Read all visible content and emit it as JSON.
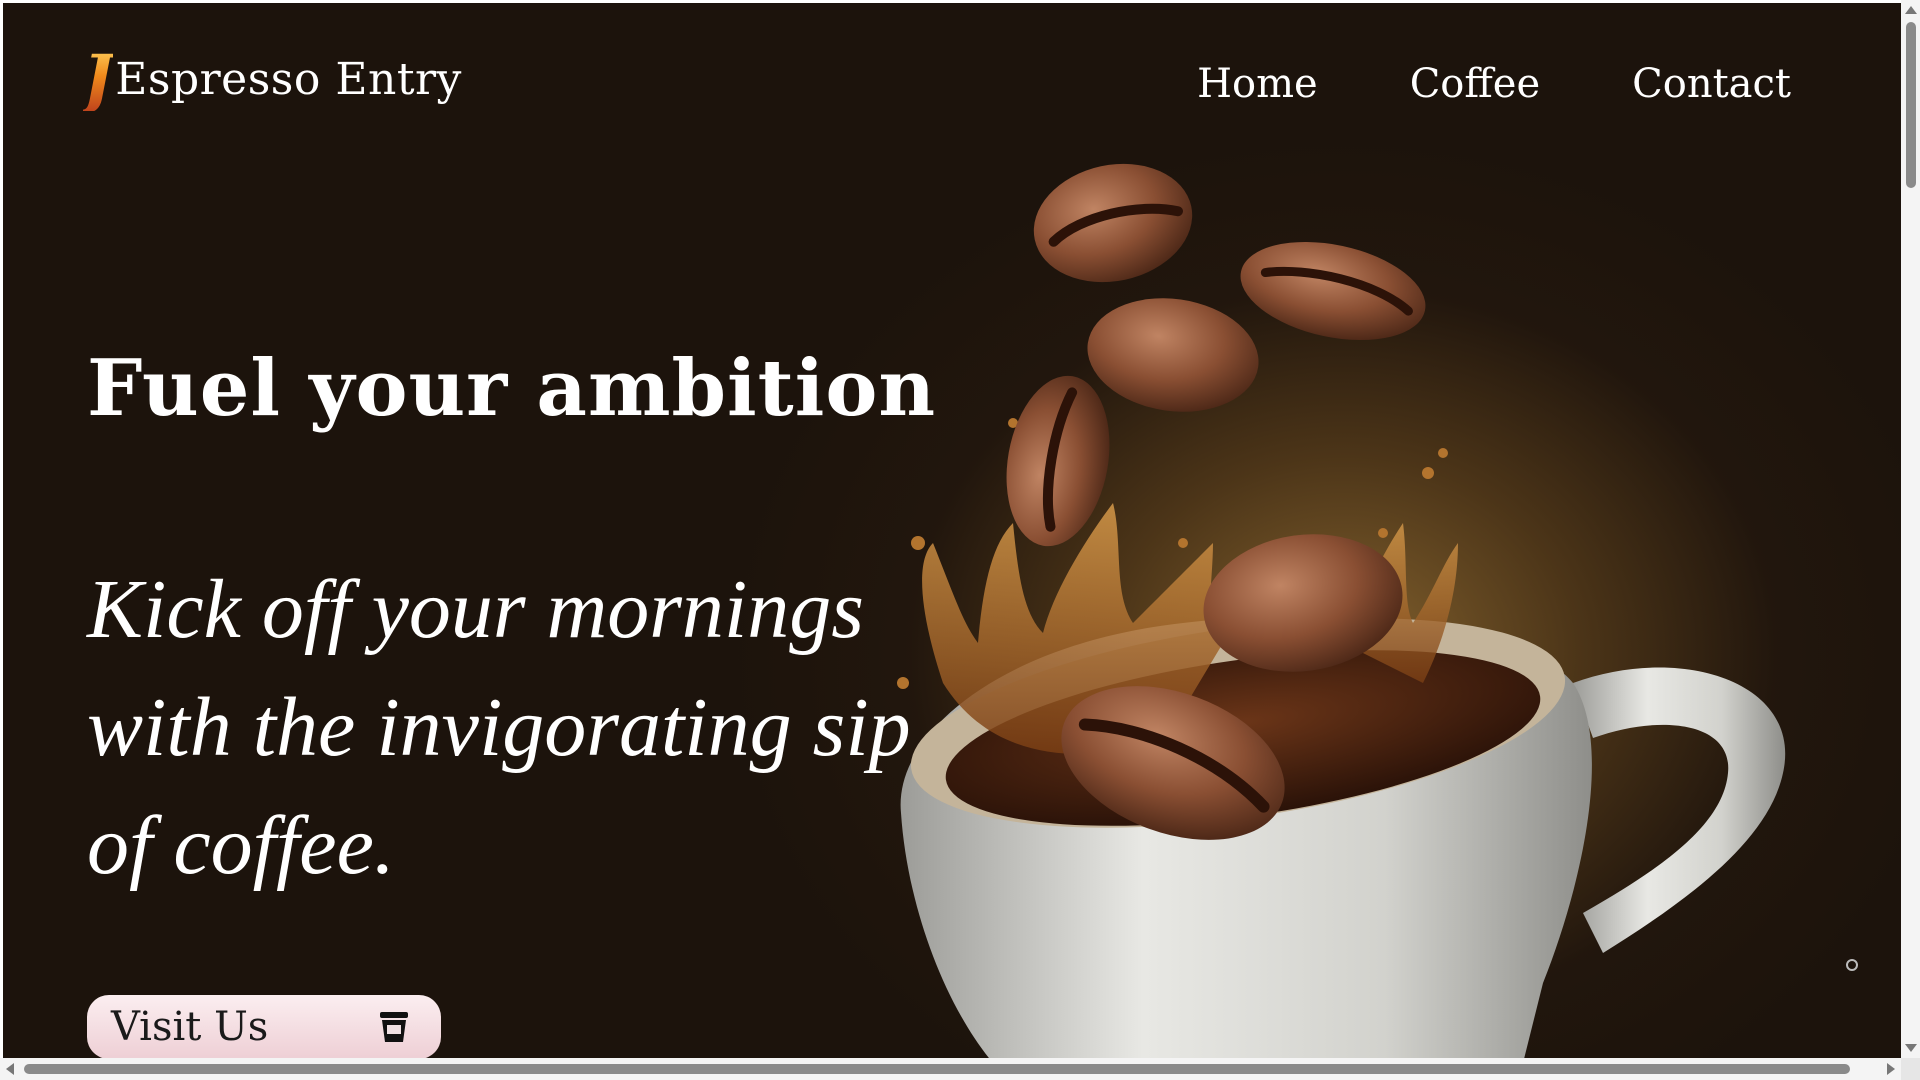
{
  "brand": {
    "mark": "J",
    "name": "Espresso Entry"
  },
  "nav": {
    "items": [
      "Home",
      "Coffee",
      "Contact"
    ]
  },
  "hero": {
    "headline": "Fuel your ambition",
    "tagline": "Kick off your mornings with the invigorating sip of coffee.",
    "cta_label": "Visit Us",
    "cta_icon": "coffee-cup-icon"
  },
  "artwork": "coffee-cup-with-flying-beans",
  "colors": {
    "background": "#1c130c",
    "text": "#ffffff",
    "cta_background": "#f3dde1",
    "brand_accent": "#f08a1c"
  }
}
